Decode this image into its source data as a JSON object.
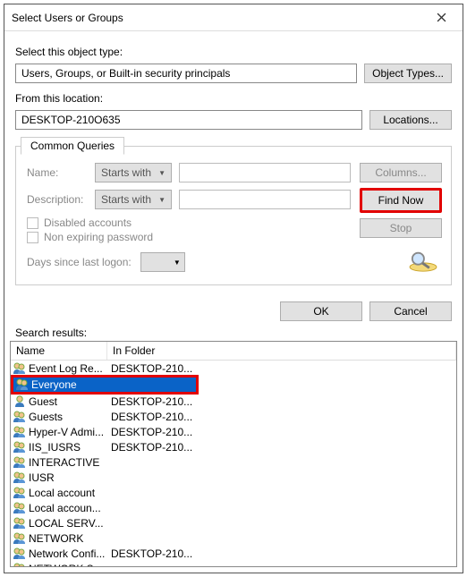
{
  "window": {
    "title": "Select Users or Groups"
  },
  "objectType": {
    "label": "Select this object type:",
    "value": "Users, Groups, or Built-in security principals",
    "button": "Object Types..."
  },
  "location": {
    "label": "From this location:",
    "value": "DESKTOP-210O635",
    "button": "Locations..."
  },
  "queries": {
    "tab": "Common Queries",
    "nameLabel": "Name:",
    "nameMode": "Starts with",
    "descLabel": "Description:",
    "descMode": "Starts with",
    "disabled": "Disabled accounts",
    "nonExpiring": "Non expiring password",
    "daysLabel": "Days since last logon:",
    "buttons": {
      "columns": "Columns...",
      "findNow": "Find Now",
      "stop": "Stop"
    }
  },
  "actions": {
    "ok": "OK",
    "cancel": "Cancel"
  },
  "results": {
    "label": "Search results:",
    "columns": {
      "name": "Name",
      "folder": "In Folder"
    },
    "rows": [
      {
        "icon": "group",
        "name": "Event Log Re...",
        "folder": "DESKTOP-210...",
        "selected": false
      },
      {
        "icon": "group",
        "name": "Everyone",
        "folder": "",
        "selected": true
      },
      {
        "icon": "user",
        "name": "Guest",
        "folder": "DESKTOP-210...",
        "selected": false
      },
      {
        "icon": "group",
        "name": "Guests",
        "folder": "DESKTOP-210...",
        "selected": false
      },
      {
        "icon": "group",
        "name": "Hyper-V Admi...",
        "folder": "DESKTOP-210...",
        "selected": false
      },
      {
        "icon": "group",
        "name": "IIS_IUSRS",
        "folder": "DESKTOP-210...",
        "selected": false
      },
      {
        "icon": "group",
        "name": "INTERACTIVE",
        "folder": "",
        "selected": false
      },
      {
        "icon": "group",
        "name": "IUSR",
        "folder": "",
        "selected": false
      },
      {
        "icon": "group",
        "name": "Local account",
        "folder": "",
        "selected": false
      },
      {
        "icon": "group",
        "name": "Local accoun...",
        "folder": "",
        "selected": false
      },
      {
        "icon": "group",
        "name": "LOCAL SERV...",
        "folder": "",
        "selected": false
      },
      {
        "icon": "group",
        "name": "NETWORK",
        "folder": "",
        "selected": false
      },
      {
        "icon": "group",
        "name": "Network Confi...",
        "folder": "DESKTOP-210...",
        "selected": false
      },
      {
        "icon": "group",
        "name": "NETWORK S...",
        "folder": "",
        "selected": false
      }
    ]
  }
}
